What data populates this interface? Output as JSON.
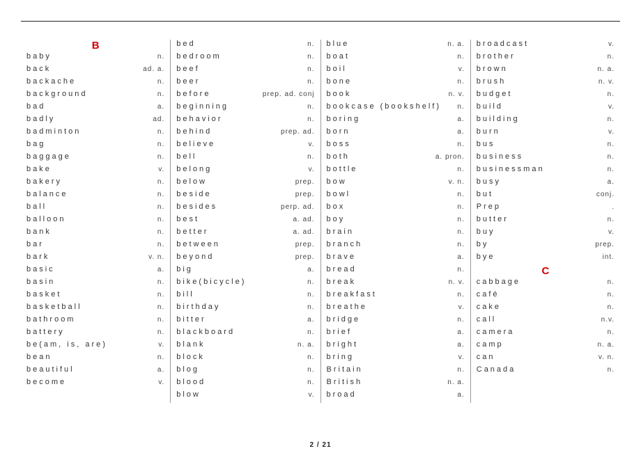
{
  "footer": "2 / 21",
  "columns": [
    [
      {
        "type": "hdr",
        "label": "B"
      },
      {
        "w": "baby",
        "p": "n."
      },
      {
        "w": "back",
        "p": "ad. a."
      },
      {
        "w": "backache",
        "p": "n."
      },
      {
        "w": "background",
        "p": "n."
      },
      {
        "w": "bad",
        "p": "a."
      },
      {
        "w": "badly",
        "p": "ad."
      },
      {
        "w": "badminton",
        "p": "n."
      },
      {
        "w": "bag",
        "p": "n."
      },
      {
        "w": "baggage",
        "p": "n."
      },
      {
        "w": "bake",
        "p": "v."
      },
      {
        "w": "bakery",
        "p": "n."
      },
      {
        "w": "balance",
        "p": "n."
      },
      {
        "w": "ball",
        "p": "n."
      },
      {
        "w": "balloon",
        "p": "n."
      },
      {
        "w": "bank",
        "p": "n."
      },
      {
        "w": "bar",
        "p": "n."
      },
      {
        "w": "bark",
        "p": "v. n."
      },
      {
        "w": "basic",
        "p": "a."
      },
      {
        "w": "basin",
        "p": "n."
      },
      {
        "w": "basket",
        "p": "n."
      },
      {
        "w": "basketball",
        "p": "n."
      },
      {
        "w": "bathroom",
        "p": "n."
      },
      {
        "w": "battery",
        "p": "n."
      },
      {
        "w": "be(am, is, are)",
        "p": "v."
      },
      {
        "w": "bean",
        "p": "n."
      },
      {
        "w": "beautiful",
        "p": "a."
      },
      {
        "w": "become",
        "p": "v."
      }
    ],
    [
      {
        "w": "bed",
        "p": "n."
      },
      {
        "w": "bedroom",
        "p": "n."
      },
      {
        "w": "beef",
        "p": "n."
      },
      {
        "w": "beer",
        "p": "n."
      },
      {
        "w": "before",
        "p": "prep. ad. conj"
      },
      {
        "w": "beginning",
        "p": "n."
      },
      {
        "w": "behavior",
        "p": "n."
      },
      {
        "w": "behind",
        "p": "prep. ad."
      },
      {
        "w": "believe",
        "p": "v."
      },
      {
        "w": "bell",
        "p": "n."
      },
      {
        "w": "belong",
        "p": "v."
      },
      {
        "w": "below",
        "p": "prep."
      },
      {
        "w": "beside",
        "p": "prep."
      },
      {
        "w": "besides",
        "p": "perp. ad."
      },
      {
        "w": "best",
        "p": "a. ad."
      },
      {
        "w": "better",
        "p": "a. ad."
      },
      {
        "w": "between",
        "p": "prep."
      },
      {
        "w": "beyond",
        "p": "prep."
      },
      {
        "w": "big",
        "p": "a."
      },
      {
        "w": "bike(bicycle)",
        "p": "n."
      },
      {
        "w": "bill",
        "p": "n."
      },
      {
        "w": "birthday",
        "p": "n."
      },
      {
        "w": "bitter",
        "p": "a."
      },
      {
        "w": "blackboard",
        "p": "n."
      },
      {
        "w": "blank",
        "p": "n. a."
      },
      {
        "w": "block",
        "p": "n."
      },
      {
        "w": "blog",
        "p": "n."
      },
      {
        "w": "blood",
        "p": "n."
      },
      {
        "w": "blow",
        "p": "v."
      }
    ],
    [
      {
        "w": "blue",
        "p": "n. a."
      },
      {
        "w": "boat",
        "p": "n."
      },
      {
        "w": "boil",
        "p": "v."
      },
      {
        "w": "bone",
        "p": "n."
      },
      {
        "w": "book",
        "p": "n. v."
      },
      {
        "w": "bookcase (bookshelf)",
        "p": "n."
      },
      {
        "w": "boring",
        "p": "a."
      },
      {
        "w": "born",
        "p": "a."
      },
      {
        "w": "boss",
        "p": "n."
      },
      {
        "w": "both",
        "p": "a. pron."
      },
      {
        "w": "bottle",
        "p": "n."
      },
      {
        "w": "bow",
        "p": "v. n."
      },
      {
        "w": "bowl",
        "p": "n."
      },
      {
        "w": "box",
        "p": "n."
      },
      {
        "w": "boy",
        "p": "n."
      },
      {
        "w": "brain",
        "p": "n."
      },
      {
        "w": "branch",
        "p": "n."
      },
      {
        "w": "brave",
        "p": "a."
      },
      {
        "w": "bread",
        "p": "n."
      },
      {
        "w": "break",
        "p": "n. v."
      },
      {
        "w": "breakfast",
        "p": "n."
      },
      {
        "w": "breathe",
        "p": "v."
      },
      {
        "w": "bridge",
        "p": "n."
      },
      {
        "w": "brief",
        "p": "a."
      },
      {
        "w": "bright",
        "p": "a."
      },
      {
        "w": "bring",
        "p": "v."
      },
      {
        "w": "Britain",
        "p": "n."
      },
      {
        "w": "British",
        "p": "n. a."
      },
      {
        "w": "broad",
        "p": "a."
      }
    ],
    [
      {
        "w": "broadcast",
        "p": "v."
      },
      {
        "w": "brother",
        "p": "n."
      },
      {
        "w": "brown",
        "p": "n. a."
      },
      {
        "w": "brush",
        "p": "n. v."
      },
      {
        "w": "budget",
        "p": "n."
      },
      {
        "w": "build",
        "p": "v."
      },
      {
        "w": "building",
        "p": "n."
      },
      {
        "w": "burn",
        "p": "v."
      },
      {
        "w": "bus",
        "p": "n."
      },
      {
        "w": "business",
        "p": "n."
      },
      {
        "w": "businessman",
        "p": "n."
      },
      {
        "w": "busy",
        "p": "a."
      },
      {
        "w": "but",
        "p": "conj."
      },
      {
        "w": "Prep",
        "p": "."
      },
      {
        "w": "butter",
        "p": "n."
      },
      {
        "w": "buy",
        "p": "v."
      },
      {
        "w": "by",
        "p": "prep."
      },
      {
        "w": "bye",
        "p": "int."
      },
      {
        "type": "hdr",
        "label": "C"
      },
      {
        "w": "cabbage",
        "p": "n."
      },
      {
        "w": "café",
        "p": "n."
      },
      {
        "w": "cake",
        "p": "n."
      },
      {
        "w": "call",
        "p": "n.v."
      },
      {
        "w": "camera",
        "p": "n."
      },
      {
        "w": "camp",
        "p": "n. a."
      },
      {
        "w": "can",
        "p": "v. n."
      },
      {
        "w": "Canada",
        "p": "n."
      }
    ]
  ]
}
